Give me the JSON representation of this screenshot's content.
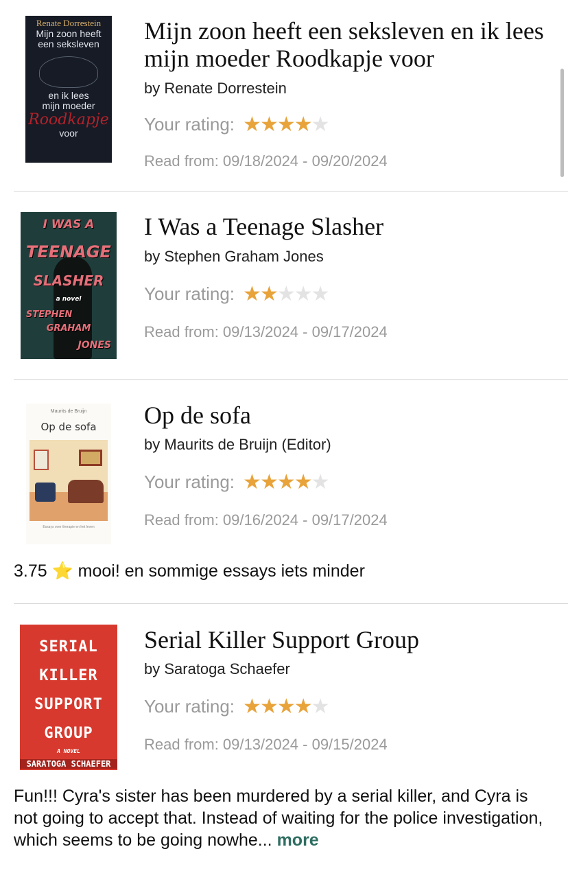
{
  "books": [
    {
      "title": "Mijn zoon heeft een seksleven en ik lees mijn moeder Roodkapje voor",
      "author": "by Renate Dorrestein",
      "rating_label": "Your rating:",
      "rating": 4,
      "read_dates": "Read from: 09/18/2024 - 09/20/2024",
      "cover": {
        "author": "Renate Dorrestein",
        "line1": "Mijn zoon heeft",
        "line2": "een seksleven",
        "line3": "en ik lees",
        "line4": "mijn moeder",
        "line5": "Roodkapje",
        "line6": "voor"
      }
    },
    {
      "title": "I Was a Teenage Slasher",
      "author": "by Stephen Graham Jones",
      "rating_label": "Your rating:",
      "rating": 2,
      "read_dates": "Read from: 09/13/2024 - 09/17/2024",
      "cover": {
        "line1": "I WAS A",
        "line2": "TEENAGE",
        "line3": "SLASHER",
        "line4": "a novel",
        "line5": "STEPHEN",
        "line6": "GRAHAM",
        "line7": "JONES"
      }
    },
    {
      "title": "Op de sofa",
      "author": "by Maurits de Bruijn (Editor)",
      "rating_label": "Your rating:",
      "rating": 4,
      "read_dates": "Read from: 09/16/2024 - 09/17/2024",
      "review": "3.75 ⭐️ mooi! en sommige essays iets minder",
      "cover": {
        "editor": "Maurits de Bruijn",
        "title": "Op de sofa",
        "subtitle": "Essays over therapie en het leven"
      }
    },
    {
      "title": "Serial Killer Support Group",
      "author": "by Saratoga Schaefer",
      "rating_label": "Your rating:",
      "rating": 4,
      "read_dates": "Read from: 09/13/2024 - 09/15/2024",
      "review": "Fun!!! Cyra's sister has been murdered by a serial killer, and Cyra is not going to accept that. Instead of waiting for the police investigation, which seems to be going nowhe...",
      "review_more": "more",
      "cover": {
        "line1": "SERIAL",
        "line2": "KILLER",
        "line3": "SUPPORT",
        "line4": "GROUP",
        "line5": "A NOVEL",
        "author": "SARATOGA SCHAEFER"
      }
    }
  ],
  "rating_max": 5,
  "colors": {
    "star_on": "#e8a33b",
    "star_off": "#e3e3e3",
    "more_link": "#2f6e62"
  }
}
